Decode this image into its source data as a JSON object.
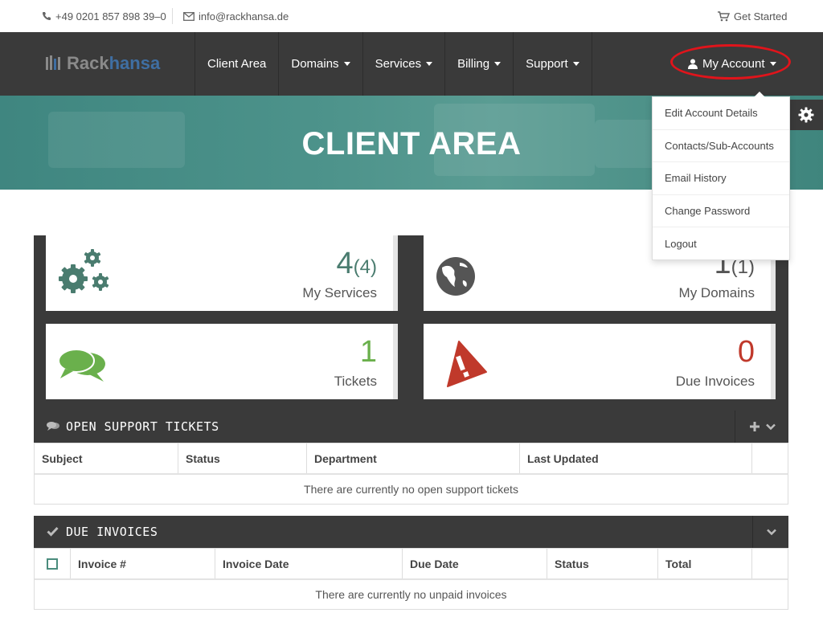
{
  "topbar": {
    "phone": "+49 0201 857 898 39–0",
    "email": "info@rackhansa.de",
    "get_started": "Get Started"
  },
  "logo": {
    "part1": "Rack",
    "part2": "hansa"
  },
  "nav": {
    "items": [
      {
        "label": "Client Area",
        "dropdown": false
      },
      {
        "label": "Domains",
        "dropdown": true
      },
      {
        "label": "Services",
        "dropdown": true
      },
      {
        "label": "Billing",
        "dropdown": true
      },
      {
        "label": "Support",
        "dropdown": true
      }
    ],
    "account_label": "My Account"
  },
  "account_menu": {
    "items": [
      "Edit Account Details",
      "Contacts/Sub-Accounts",
      "Email History",
      "Change Password",
      "Logout"
    ]
  },
  "hero": {
    "title": "CLIENT AREA"
  },
  "tiles": {
    "services": {
      "count": "4",
      "total": "(4)",
      "label": "My Services",
      "color": "#4a7c6f"
    },
    "domains": {
      "count": "1",
      "total": "(1)",
      "label": "My Domains",
      "color": "#555555"
    },
    "tickets": {
      "count": "1",
      "label": "Tickets",
      "color": "#6ab04c"
    },
    "invoices": {
      "count": "0",
      "label": "Due Invoices",
      "color": "#c0392b"
    }
  },
  "support_panel": {
    "title": "OPEN SUPPORT TICKETS",
    "columns": [
      "Subject",
      "Status",
      "Department",
      "Last Updated"
    ],
    "empty_text": "There are currently no open support tickets"
  },
  "invoices_panel": {
    "title": "DUE INVOICES",
    "columns": [
      "Invoice #",
      "Invoice Date",
      "Due Date",
      "Status",
      "Total"
    ],
    "empty_text": "There are currently no unpaid invoices"
  },
  "colors": {
    "nav_bg": "#3a3a3a",
    "hero_bg": "#4d938b",
    "highlight": "#e0141b"
  }
}
